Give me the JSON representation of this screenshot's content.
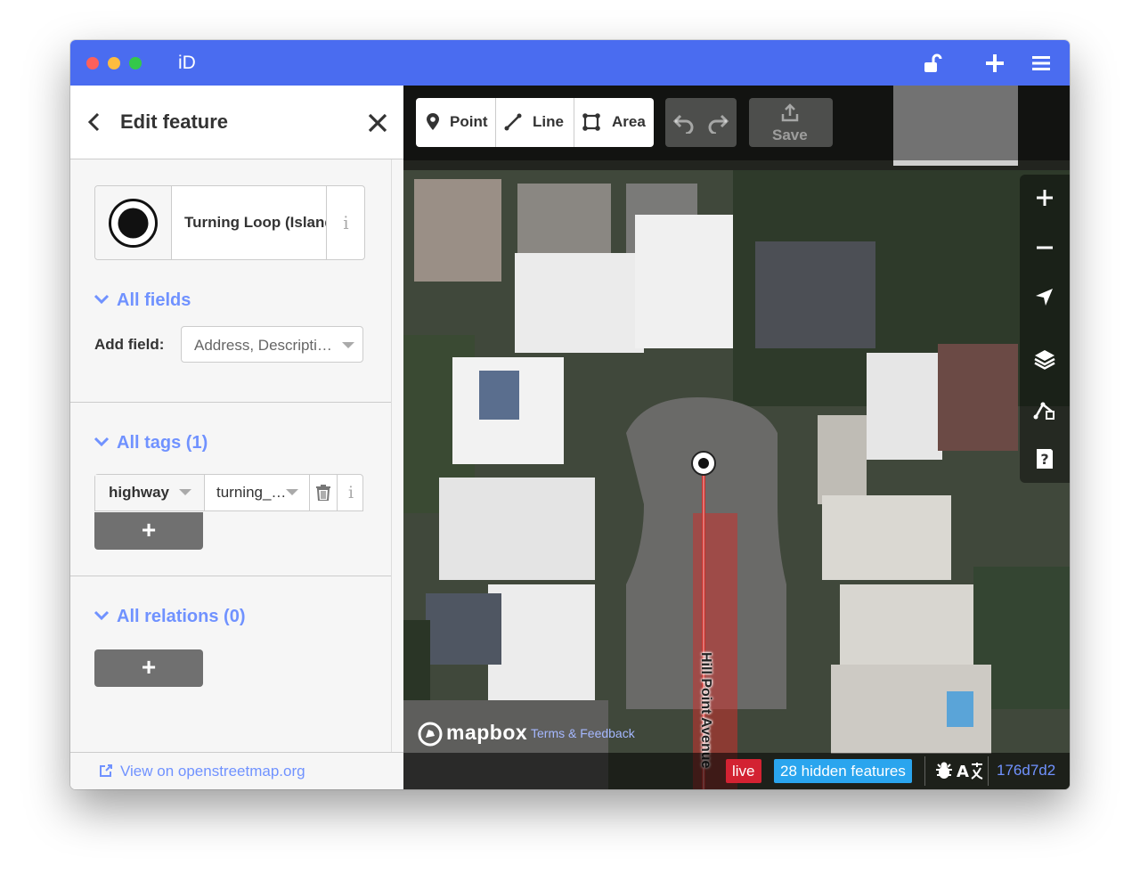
{
  "window": {
    "title": "iD"
  },
  "titlebar_icons": [
    "unlock-icon",
    "plus-icon",
    "menu-icon"
  ],
  "sidebar": {
    "header_title": "Edit feature",
    "preset": {
      "name": "Turning Loop (Island)",
      "info": "i"
    },
    "sections": {
      "fields": "All fields",
      "tags": "All tags (1)",
      "relations": "All relations (0)"
    },
    "add_field": {
      "label": "Add field:",
      "placeholder": "Address, Descripti…"
    },
    "tag": {
      "key": "highway",
      "value": "turning_…",
      "info": "i"
    },
    "add_symbol": "+",
    "footer_link": "View on openstreetmap.org"
  },
  "map": {
    "toolbar": {
      "point": "Point",
      "line": "Line",
      "area": "Area",
      "save": "Save"
    },
    "street_name": "Hill Point Avenue",
    "attribution": {
      "brand": "mapbox",
      "terms": "Terms & Feedback"
    },
    "footer": {
      "live": "live",
      "hidden": "28 hidden features",
      "version": "176d7d2"
    }
  },
  "colors": {
    "titlebar": "#4a6cf0",
    "accent": "#7092ff",
    "live_badge": "#d32232",
    "hidden_badge": "#2aa5ee",
    "highlight_road": "#c8322d"
  }
}
